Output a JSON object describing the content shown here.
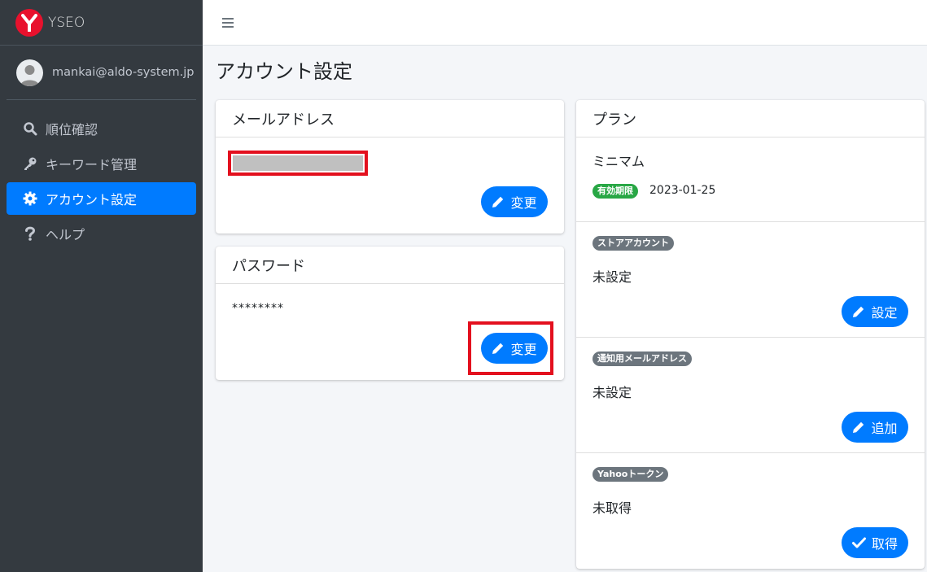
{
  "brand": {
    "name": "YSEO"
  },
  "user": {
    "email": "mankai@aldo-system.jp"
  },
  "nav": {
    "items": [
      {
        "label": "順位確認",
        "icon": "search-icon"
      },
      {
        "label": "キーワード管理",
        "icon": "key-icon"
      },
      {
        "label": "アカウント設定",
        "icon": "gear-icon",
        "active": true
      },
      {
        "label": "ヘルプ",
        "icon": "question-icon"
      }
    ]
  },
  "page": {
    "title": "アカウント設定"
  },
  "email_card": {
    "title": "メールアドレス",
    "button": "変更"
  },
  "password_card": {
    "title": "パスワード",
    "value": "********",
    "button": "変更"
  },
  "plan_card": {
    "title": "プラン",
    "plan_name": "ミニマム",
    "expiry_badge": "有効期限",
    "expiry_date": "2023-01-25",
    "store_account": {
      "badge": "ストアアカウント",
      "value": "未設定",
      "button": "設定"
    },
    "notify_email": {
      "badge": "通知用メールアドレス",
      "value": "未設定",
      "button": "追加"
    },
    "yahoo_token": {
      "badge": "Yahooトークン",
      "value": "未取得",
      "button": "取得"
    }
  },
  "colors": {
    "primary": "#007bff",
    "sidebar": "#343a40",
    "success": "#28a745",
    "secondary": "#6c757d",
    "highlight": "#e3101e"
  }
}
